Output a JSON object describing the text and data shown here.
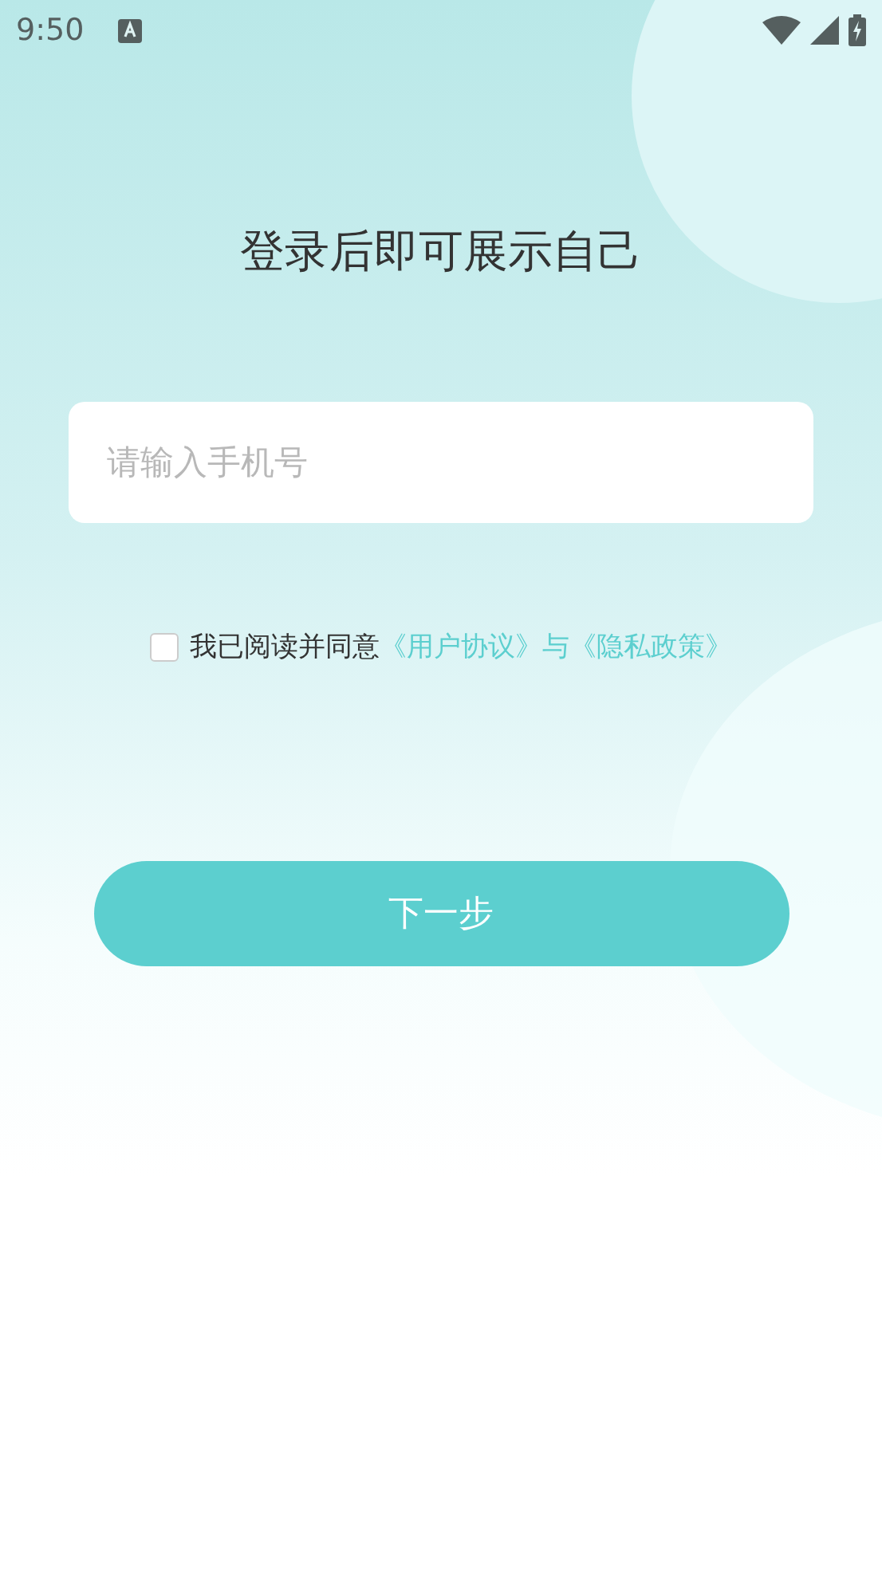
{
  "status_bar": {
    "time": "9:50"
  },
  "title": "登录后即可展示自己",
  "phone_field": {
    "placeholder": "请输入手机号"
  },
  "agreement": {
    "checked": false,
    "text": "我已阅读并同意",
    "user_agreement": "《用户协议》",
    "conjunction": "与",
    "privacy_policy": "《隐私政策》"
  },
  "next_button": {
    "label": "下一步"
  }
}
